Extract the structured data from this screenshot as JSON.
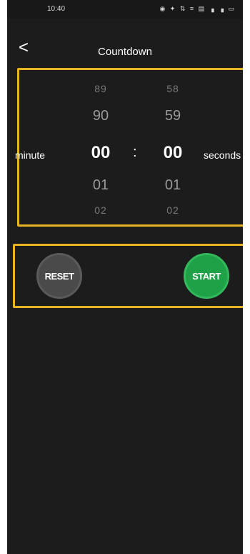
{
  "status_bar": {
    "time": "10:40",
    "icons": "◉ ✦ ⇅ ≡ ▤ ▗ ▗ ▭"
  },
  "header": {
    "back_icon": "<",
    "title": "Countdown"
  },
  "picker": {
    "minutes": [
      "89",
      "90",
      "00",
      "01",
      "02"
    ],
    "seconds": [
      "58",
      "59",
      "00",
      "01",
      "02"
    ],
    "separator": ":",
    "minute_label": "minute",
    "seconds_label": "seconds"
  },
  "controls": {
    "reset_label": "RESET",
    "start_label": "START"
  },
  "colors": {
    "highlight": "#e8b322",
    "start": "#1fa247",
    "reset": "#4a4a4a",
    "background": "#1c1c1c"
  }
}
